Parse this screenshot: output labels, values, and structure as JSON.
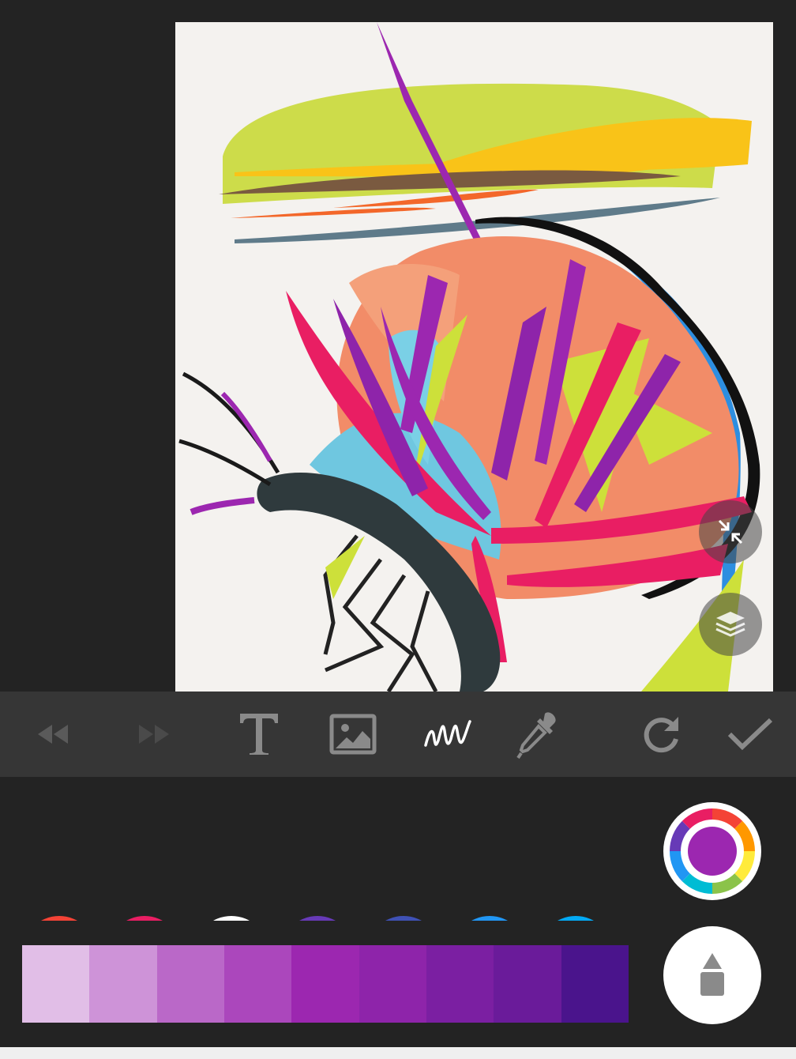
{
  "colors": {
    "background": "#232323",
    "toolbar": "#363636",
    "canvas": "#f4f2ef",
    "active_tool": "#ffffff",
    "inactive_tool": "#8a8a8a",
    "disabled_tool": "#5a5a5a",
    "selected_color": "#9c27b0"
  },
  "toolbar": {
    "tools": [
      {
        "icon": "rewind-icon",
        "state": "disabled"
      },
      {
        "icon": "fast-forward-icon",
        "state": "disabled"
      },
      {
        "icon": "text-tool-icon",
        "state": "enabled"
      },
      {
        "icon": "image-tool-icon",
        "state": "enabled"
      },
      {
        "icon": "brush-stroke-icon",
        "state": "active"
      },
      {
        "icon": "eyedropper-icon",
        "state": "enabled"
      },
      {
        "icon": "redo-icon",
        "state": "enabled"
      },
      {
        "icon": "check-icon",
        "state": "enabled"
      }
    ]
  },
  "palette": {
    "swatches": [
      "#f44336",
      "#e91e63",
      "#9c27b0",
      "#673ab7",
      "#3f51b5",
      "#2196f3",
      "#03a9f4",
      "#00bcd4"
    ],
    "selected_index": 2,
    "shades": [
      "#e1bee7",
      "#ce93d8",
      "#ba68c8",
      "#ab47bc",
      "#9c27b0",
      "#8e24aa",
      "#7b1fa2",
      "#6a1b9a",
      "#4a148c"
    ]
  },
  "floating": {
    "collapse": "collapse-icon",
    "layers": "layers-icon"
  }
}
